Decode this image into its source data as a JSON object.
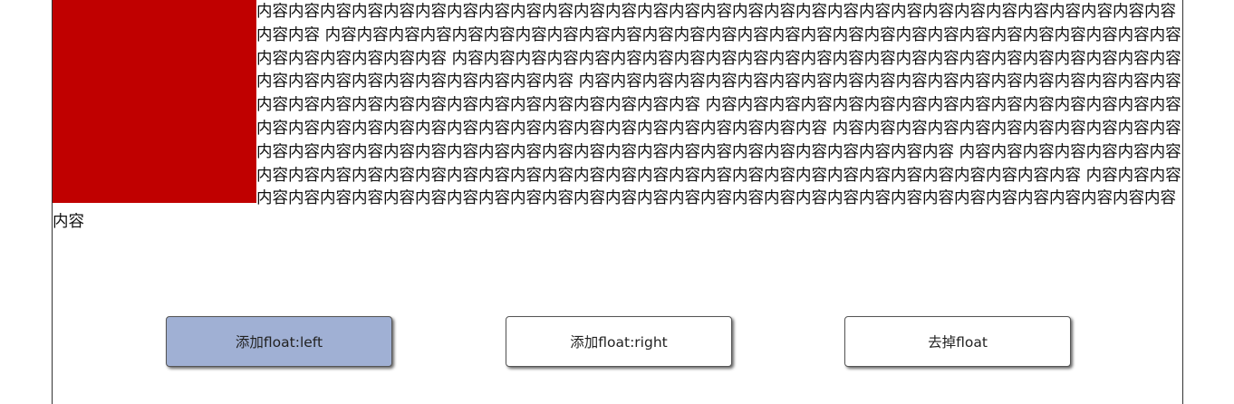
{
  "content": {
    "segments": [
      "内容内容内容内容内容内容内容内容内容内容内容内容内容内容内容内容内容内容内容内容内容内容内容内容内容内容内容内容内容内容内容",
      "内容内容内容内容内容内容内容内容内容内容内容内容内容内容内容内容内容内容内容内容内容内容内容内容内容内容内容内容内容内容内容内容内容",
      "内容内容内容内容内容内容内容内容内容内容内容内容内容内容内容内容内容内容内容内容内容内容内容内容内容内容内容内容内容内容内容内容内容",
      "内容内容内容内容内容内容内容内容内容内容内容内容内容内容内容内容内容内容内容内容内容内容内容内容内容内容内容内容内容内容内容内容内容",
      "内容内容内容内容内容内容内容内容内容内容内容内容内容内容内容内容内容内容内容内容内容内容内容内容内容内容内容内容内容内容内容内容内容",
      "内容内容内容内容内容内容内容内容内容内容内容内容内容内容内容内容内容内容内容内容内容内容内容内容内容内容内容内容内容内容内容内容内容",
      "内容内容内容内容内容内容内容内容内容内容内容内容内容内容内容内容内容内容内容内容内容内容内容内容内容内容内容内容内容内容内容内容内容",
      "内容内容内容内容内容内容内容内容内容内容内容内容内容内容内容内容内容内容内容内容内容内容内容内容内容内容内容内容内容内容内容内容内容"
    ]
  },
  "buttons": {
    "float_left": "添加float:left",
    "float_right": "添加float:right",
    "remove_float": "去掉float"
  },
  "colors": {
    "float_box": "#c00000",
    "active_button": "#a0b0d4"
  }
}
